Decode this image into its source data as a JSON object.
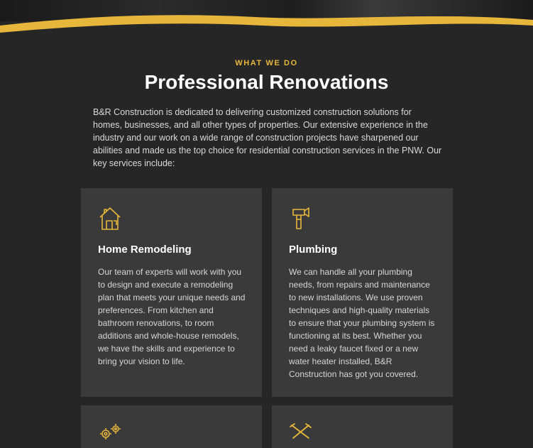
{
  "section": {
    "eyebrow": "WHAT WE DO",
    "title": "Professional Renovations",
    "intro": "B&R Construction is dedicated to delivering customized construction solutions for homes, businesses, and all other types of properties. Our extensive experience in the industry and our work on a wide range of construction projects have sharpened our abilities and made us the top choice for residential construction services in the PNW. Our key services include:"
  },
  "colors": {
    "accent": "#e7b73c",
    "background": "#262626",
    "card": "#3a3a3a"
  },
  "services": [
    {
      "icon": "house-plan-icon",
      "title": "Home Remodeling",
      "text": "Our team of experts will work with you to design and execute a remodeling plan that meets your unique needs and preferences. From kitchen and bathroom renovations, to room additions and whole-house remodels, we have the skills and experience to bring your vision to life."
    },
    {
      "icon": "hammer-icon",
      "title": "Plumbing",
      "text": "We can handle all your plumbing needs, from repairs and maintenance to new installations. We use proven techniques and high-quality materials to ensure that your plumbing system is functioning at its best. Whether you need a leaky faucet fixed or a new water heater installed, B&R Construction has got you covered."
    },
    {
      "icon": "gears-icon"
    },
    {
      "icon": "crossed-tools-icon"
    }
  ]
}
